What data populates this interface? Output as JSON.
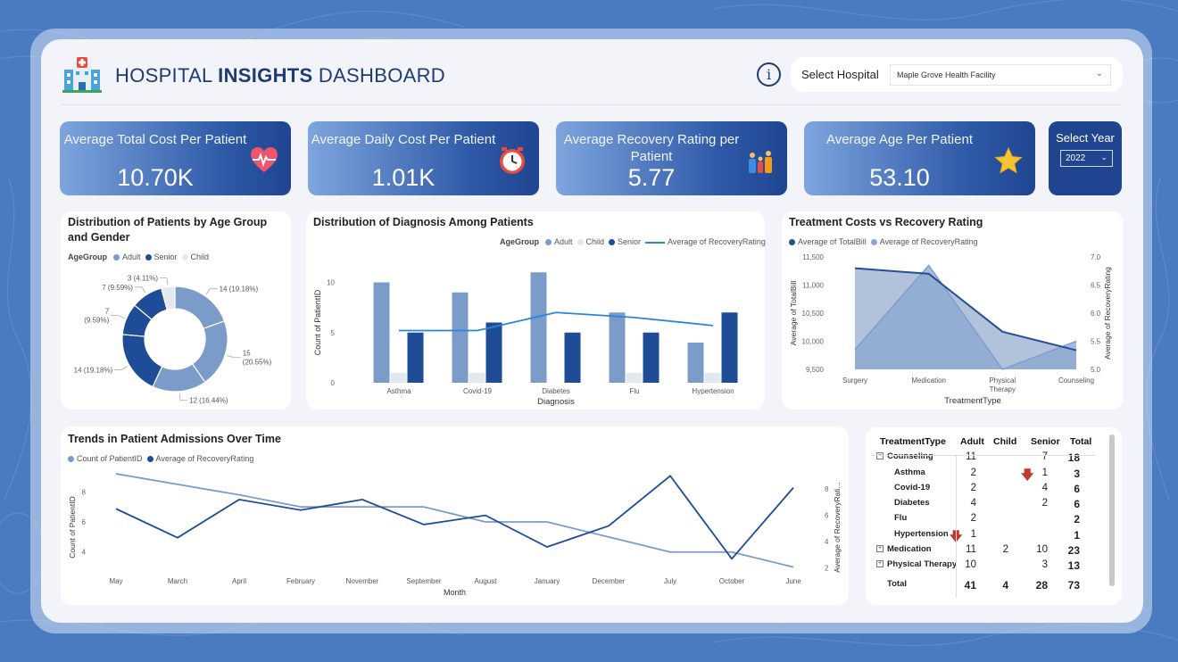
{
  "header": {
    "title_pre": "HOSPITAL ",
    "title_bold": "INSIGHTS",
    "title_post": " DASHBOARD",
    "info_glyph": "i",
    "hospital_label": "Select Hospital",
    "hospital_value": "Maple Grove Health Facility",
    "chevron": "⌄"
  },
  "kpis": [
    {
      "title": "Average Total Cost Per Patient",
      "value": "10.70K",
      "icon": "heart-pulse-icon"
    },
    {
      "title": "Average Daily Cost Per Patient",
      "value": "1.01K",
      "icon": "clock-icon"
    },
    {
      "title": "Average Recovery Rating per Patient",
      "value": "5.77",
      "icon": "family-icon"
    },
    {
      "title": "Average Age Per Patient",
      "value": "53.10",
      "icon": "star-icon"
    }
  ],
  "year": {
    "label": "Select Year",
    "value": "2022",
    "chevron": "⌄"
  },
  "colors": {
    "adult": "#7b9cc9",
    "senior": "#1f4c96",
    "child": "#e3e7ee",
    "line": "#2c86d8",
    "area_cost": "#234f95",
    "area_rating": "#8aa6d0"
  },
  "donut": {
    "title": "Distribution of Patients by Age Group and Gender",
    "legend_title": "AgeGroup",
    "legend": [
      "Adult",
      "Senior",
      "Child"
    ],
    "chart_data": {
      "type": "pie",
      "slices": [
        {
          "group": "Adult",
          "value": 14,
          "label": "14 (19.18%)"
        },
        {
          "group": "Adult",
          "value": 15,
          "label": "15 (20.55%)"
        },
        {
          "group": "Adult",
          "value": 12,
          "label": "12 (16.44%)"
        },
        {
          "group": "Senior",
          "value": 14,
          "label": "14 (19.18%)"
        },
        {
          "group": "Senior",
          "value": 7,
          "label": "7 (9.59%)"
        },
        {
          "group": "Senior",
          "value": 7,
          "label": "7 (9.59%)"
        },
        {
          "group": "Child",
          "value": 3,
          "label": "3 (4.11%)"
        }
      ]
    }
  },
  "diag": {
    "title": "Distribution of Diagnosis Among Patients",
    "legend_title": "AgeGroup",
    "legend": [
      "Adult",
      "Child",
      "Senior",
      "Average of RecoveryRating"
    ],
    "chart_data": {
      "type": "bar",
      "categories": [
        "Asthma",
        "Covid-19",
        "Diabetes",
        "Flu",
        "Hypertension"
      ],
      "series": [
        {
          "name": "Adult",
          "values": [
            10,
            9,
            11,
            7,
            4
          ]
        },
        {
          "name": "Child",
          "values": [
            1,
            1,
            0,
            1,
            1
          ]
        },
        {
          "name": "Senior",
          "values": [
            5,
            6,
            5,
            5,
            7
          ]
        }
      ],
      "line": {
        "name": "Average of RecoveryRating",
        "values": [
          5.2,
          5.2,
          7.0,
          6.5,
          5.7
        ]
      },
      "xlabel": "Diagnosis",
      "ylabel": "Count of PatientID",
      "yticks": [
        0,
        5,
        10
      ],
      "ylim": [
        0,
        12
      ]
    }
  },
  "treat": {
    "title": "Treatment Costs vs Recovery Rating",
    "legend": [
      "Average of TotalBill",
      "Average of RecoveryRating"
    ],
    "chart_data": {
      "type": "area",
      "categories": [
        "Surgery",
        "Medication",
        "Physical Therapy",
        "Counseling"
      ],
      "series": [
        {
          "name": "Average of TotalBill",
          "values": [
            11300,
            11200,
            10170,
            9840
          ]
        },
        {
          "name": "Average of RecoveryRating",
          "values": [
            5.35,
            6.85,
            5.0,
            5.5
          ]
        }
      ],
      "xlabel": "TreatmentType",
      "ylabel": "Average of TotalBill",
      "y2label": "Average of RecoveryRating",
      "yticks": [
        "9,500",
        "10,000",
        "10,500",
        "11,000",
        "11,500"
      ],
      "y2ticks": [
        "5.0",
        "5.5",
        "6.0",
        "6.5",
        "7.0"
      ],
      "ylim": [
        9500,
        11500
      ],
      "y2lim": [
        5.0,
        7.0
      ]
    }
  },
  "trend": {
    "title": "Trends in Patient Admissions Over Time",
    "legend": [
      "Count of PatientID",
      "Average of RecoveryRating"
    ],
    "chart_data": {
      "type": "line",
      "x": [
        "May",
        "March",
        "April",
        "February",
        "November",
        "September",
        "August",
        "January",
        "December",
        "July",
        "October",
        "June"
      ],
      "series": [
        {
          "name": "Count of PatientID",
          "values": [
            9.2,
            8.5,
            7.8,
            7.0,
            7.0,
            7.0,
            6.0,
            6.0,
            5.0,
            4.0,
            4.0,
            3.0
          ]
        },
        {
          "name": "Average of RecoveryRating",
          "values": [
            6.5,
            4.3,
            7.2,
            6.4,
            7.2,
            5.3,
            6.0,
            3.6,
            5.2,
            9.0,
            2.7,
            8.1
          ]
        }
      ],
      "xlabel": "Month",
      "ylabel": "Count of PatientID",
      "y2label": "Average of RecoveryRati...",
      "yticks": [
        4,
        6,
        8
      ],
      "y2ticks": [
        2,
        4,
        6,
        8
      ],
      "ylim": [
        2.5,
        9.5
      ],
      "y2lim": [
        1.5,
        9.5
      ]
    }
  },
  "matrix": {
    "headers": [
      "TreatmentType",
      "Adult",
      "Child",
      "Senior",
      "Total"
    ],
    "rows": [
      {
        "name": "Counseling",
        "level": 0,
        "expander": "⊟",
        "adult": "11",
        "child": "",
        "senior": "7",
        "total": "18"
      },
      {
        "name": "Asthma",
        "level": 1,
        "adult": "2",
        "child": "",
        "senior": "1",
        "total": "3",
        "arrow": "senior"
      },
      {
        "name": "Covid-19",
        "level": 1,
        "adult": "2",
        "child": "",
        "senior": "4",
        "total": "6"
      },
      {
        "name": "Diabetes",
        "level": 1,
        "adult": "4",
        "child": "",
        "senior": "2",
        "total": "6"
      },
      {
        "name": "Flu",
        "level": 1,
        "adult": "2",
        "child": "",
        "senior": "",
        "total": "2"
      },
      {
        "name": "Hypertension",
        "level": 1,
        "adult": "1",
        "child": "",
        "senior": "",
        "total": "1",
        "arrow": "adult"
      },
      {
        "name": "Medication",
        "level": 0,
        "expander": "⊞",
        "adult": "11",
        "child": "2",
        "senior": "10",
        "total": "23"
      },
      {
        "name": "Physical Therapy",
        "level": 0,
        "expander": "⊞",
        "adult": "10",
        "child": "",
        "senior": "3",
        "total": "13"
      }
    ],
    "total": {
      "name": "Total",
      "adult": "41",
      "child": "4",
      "senior": "28",
      "total": "73"
    },
    "arrow_glyph": "🡇"
  }
}
